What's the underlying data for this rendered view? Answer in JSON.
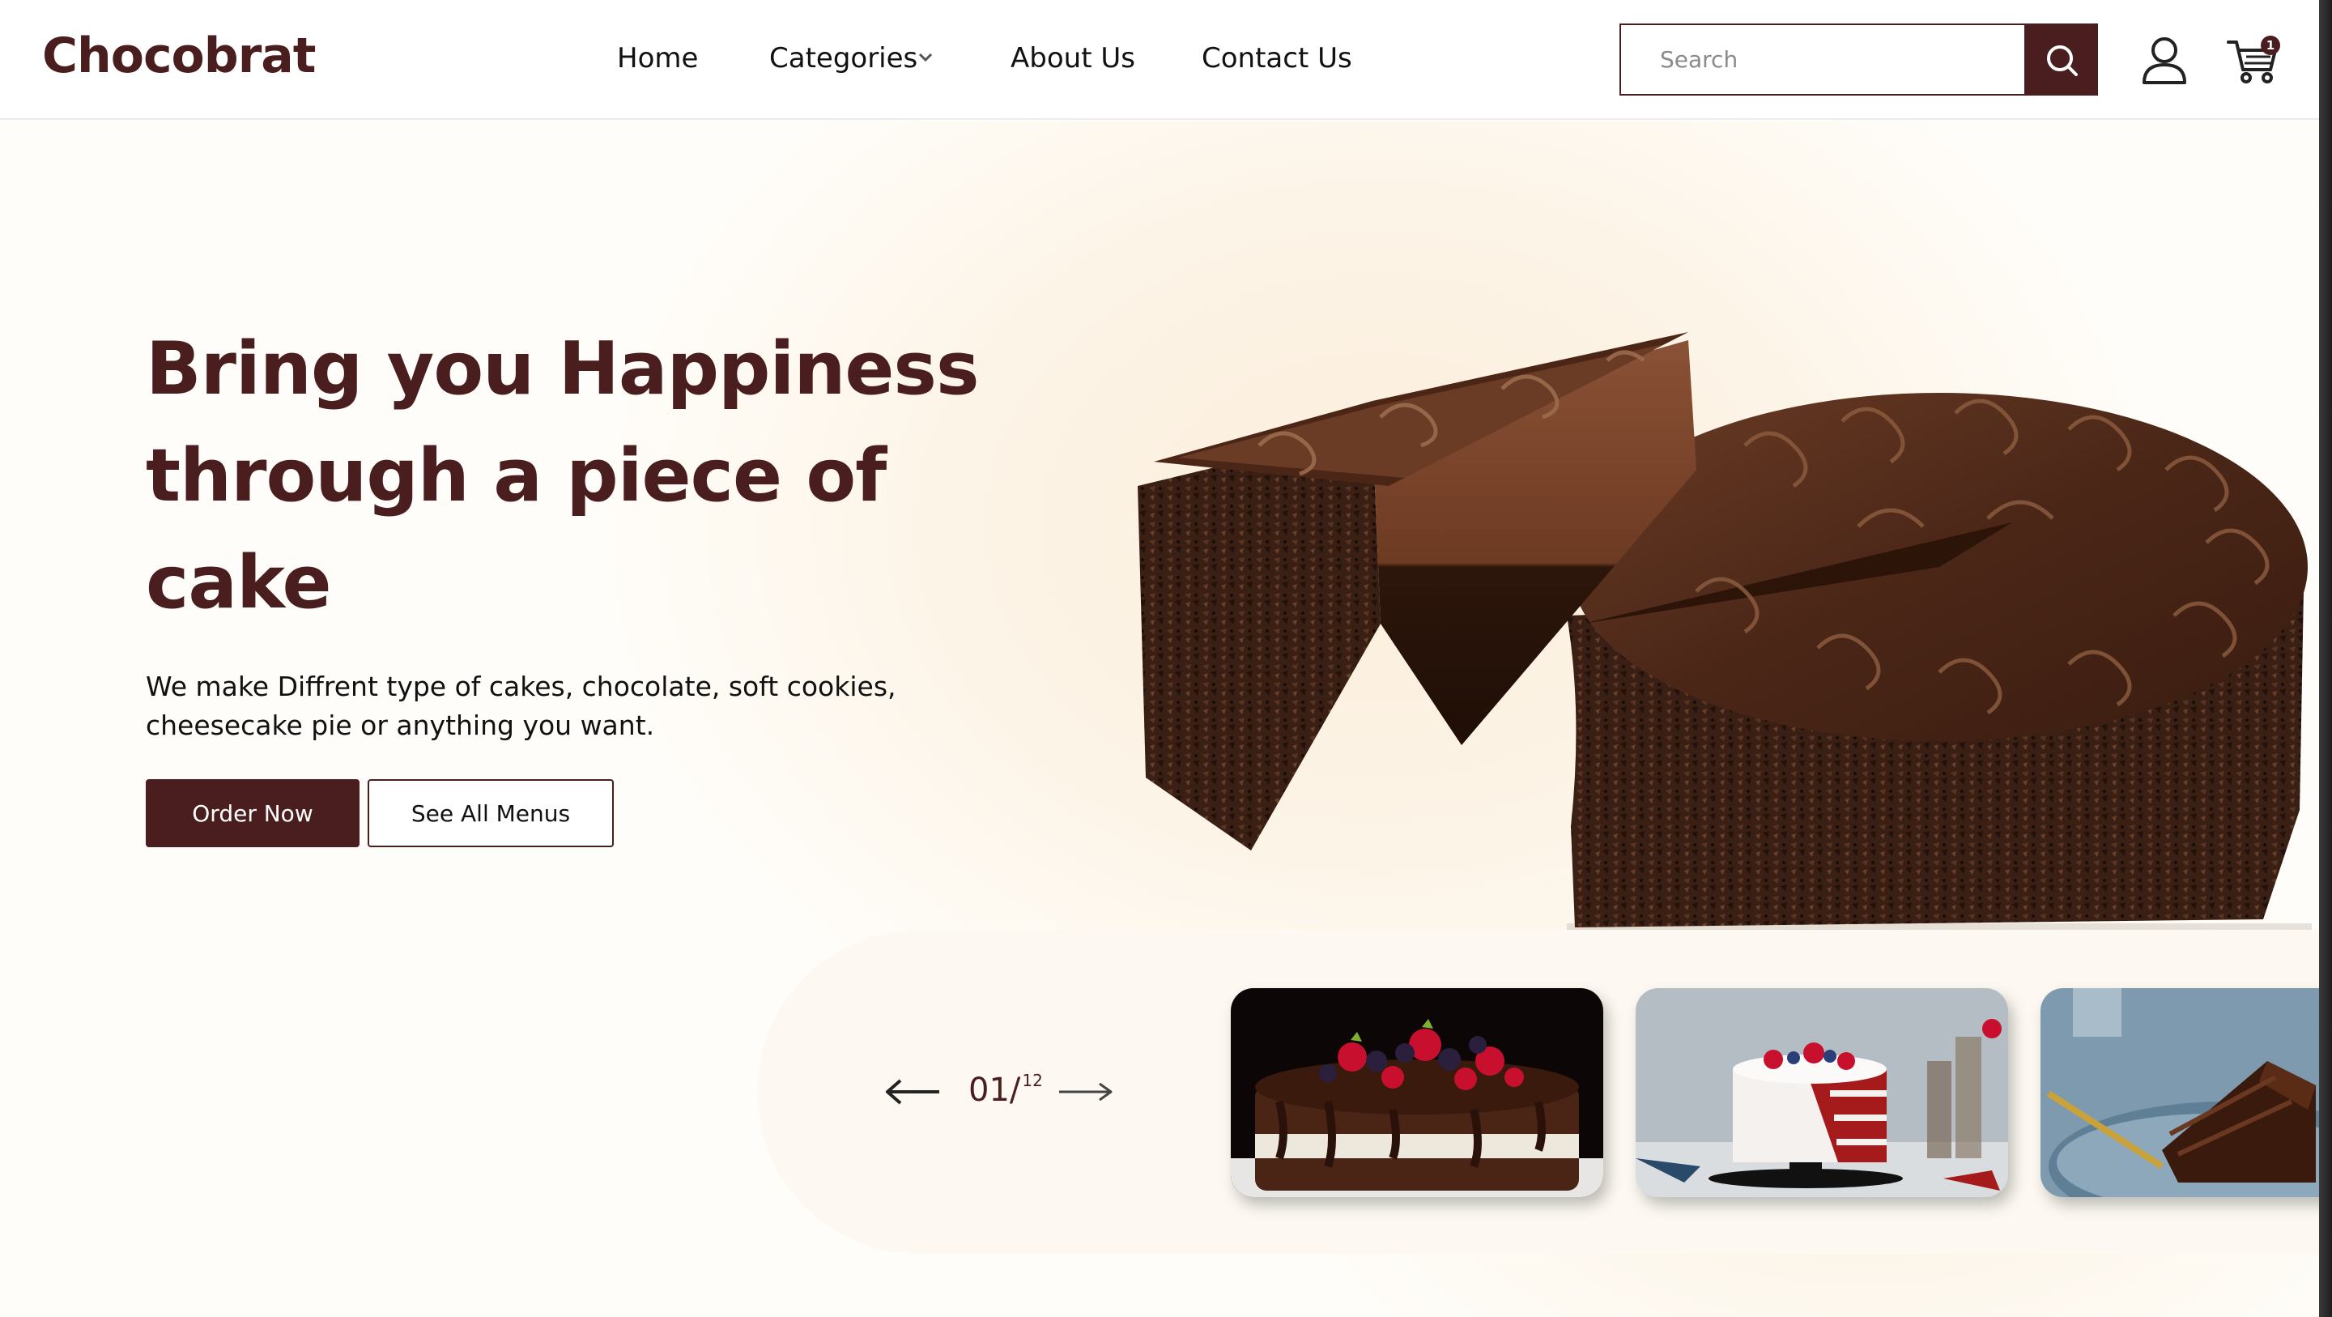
{
  "brand": {
    "name": "Chocobrat"
  },
  "nav": {
    "home": "Home",
    "categories": "Categories",
    "about": "About Us",
    "contact": "Contact Us"
  },
  "search": {
    "placeholder": "Search"
  },
  "cart": {
    "count": "1"
  },
  "icons": {
    "search": "search-icon",
    "user": "user-icon",
    "cart": "cart-icon",
    "chevron": "chevron-down-icon",
    "prev": "arrow-left-icon",
    "next": "arrow-right-icon"
  },
  "hero": {
    "headline": "Bring you Happiness through a piece of cake",
    "subtext": "We make Diffrent type of cakes, chocolate, soft cookies, cheesecake pie or anything you want.",
    "order_button": "Order Now",
    "menus_button": "See All Menus"
  },
  "carousel": {
    "current": "01/",
    "total": "12"
  },
  "colors": {
    "brand": "#4a1d1f",
    "background": "#fffdf9",
    "panel": "#fdf9f2"
  }
}
